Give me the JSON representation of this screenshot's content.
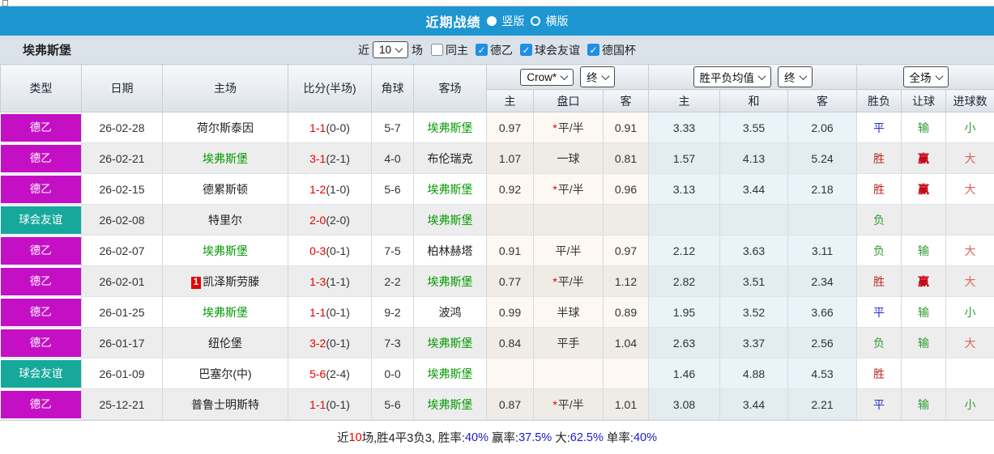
{
  "title_bar": {
    "title": "近期战绩",
    "radio_vertical_label": "竖版",
    "radio_horizontal_label": "横版"
  },
  "filter_bar": {
    "team": "埃弗斯堡",
    "near_label": "近",
    "count_value": "10",
    "games_label": "场",
    "checkboxes": [
      {
        "label": "同主",
        "checked": false
      },
      {
        "label": "德乙",
        "checked": true
      },
      {
        "label": "球会友谊",
        "checked": true
      },
      {
        "label": "德国杯",
        "checked": true
      }
    ]
  },
  "table": {
    "dropdowns": {
      "odds_company": "Crow*",
      "odds_final": "终",
      "avg_type": "胜平负均值",
      "avg_final": "终",
      "full_match": "全场"
    },
    "columns": [
      "类型",
      "日期",
      "主场",
      "比分(半场)",
      "角球",
      "客场"
    ],
    "sub_columns": [
      "主",
      "盘口",
      "客",
      "主",
      "和",
      "客",
      "胜负",
      "让球",
      "进球数"
    ],
    "rows": [
      {
        "type": "德乙",
        "type_color": "magenta",
        "date": "26-02-28",
        "home": "荷尔斯泰因",
        "home_badge": "",
        "home_is_team": false,
        "score": "1-1",
        "half": "(0-0)",
        "corner": "5-7",
        "away": "埃弗斯堡",
        "away_is_team": true,
        "odds_home": "0.97",
        "handicap_star": "*",
        "handicap": "平/半",
        "odds_away": "0.91",
        "avg_home": "3.33",
        "avg_draw": "3.55",
        "avg_away": "2.06",
        "results": [
          {
            "t": "平",
            "c": "blue"
          },
          {
            "t": "输",
            "c": "green"
          },
          {
            "t": "小",
            "c": "green"
          }
        ]
      },
      {
        "type": "德乙",
        "type_color": "magenta",
        "date": "26-02-21",
        "home": "埃弗斯堡",
        "home_badge": "",
        "home_is_team": true,
        "score": "3-1",
        "half": "(2-1)",
        "corner": "4-0",
        "away": "布伦瑞克",
        "away_is_team": false,
        "odds_home": "1.07",
        "handicap_star": "",
        "handicap": "一球",
        "odds_away": "0.81",
        "avg_home": "1.57",
        "avg_draw": "4.13",
        "avg_away": "5.24",
        "results": [
          {
            "t": "胜",
            "c": "red1"
          },
          {
            "t": "赢",
            "c": "red2"
          },
          {
            "t": "大",
            "c": "red3"
          }
        ]
      },
      {
        "type": "德乙",
        "type_color": "magenta",
        "date": "26-02-15",
        "home": "德累斯顿",
        "home_badge": "",
        "home_is_team": false,
        "score": "1-2",
        "half": "(1-0)",
        "corner": "5-6",
        "away": "埃弗斯堡",
        "away_is_team": true,
        "odds_home": "0.92",
        "handicap_star": "*",
        "handicap": "平/半",
        "odds_away": "0.96",
        "avg_home": "3.13",
        "avg_draw": "3.44",
        "avg_away": "2.18",
        "results": [
          {
            "t": "胜",
            "c": "red1"
          },
          {
            "t": "赢",
            "c": "red2"
          },
          {
            "t": "大",
            "c": "red3"
          }
        ]
      },
      {
        "type": "球会友谊",
        "type_color": "teal",
        "date": "26-02-08",
        "home": "特里尔",
        "home_badge": "",
        "home_is_team": false,
        "score": "2-0",
        "half": "(2-0)",
        "corner": "",
        "away": "埃弗斯堡",
        "away_is_team": true,
        "odds_home": "",
        "handicap_star": "",
        "handicap": "",
        "odds_away": "",
        "avg_home": "",
        "avg_draw": "",
        "avg_away": "",
        "results": [
          {
            "t": "负",
            "c": "green"
          },
          {
            "t": "",
            "c": ""
          },
          {
            "t": "",
            "c": ""
          }
        ]
      },
      {
        "type": "德乙",
        "type_color": "magenta",
        "date": "26-02-07",
        "home": "埃弗斯堡",
        "home_badge": "",
        "home_is_team": true,
        "score": "0-3",
        "half": "(0-1)",
        "corner": "7-5",
        "away": "柏林赫塔",
        "away_is_team": false,
        "odds_home": "0.91",
        "handicap_star": "",
        "handicap": "平/半",
        "odds_away": "0.97",
        "avg_home": "2.12",
        "avg_draw": "3.63",
        "avg_away": "3.11",
        "results": [
          {
            "t": "负",
            "c": "green"
          },
          {
            "t": "输",
            "c": "green"
          },
          {
            "t": "大",
            "c": "red3"
          }
        ]
      },
      {
        "type": "德乙",
        "type_color": "magenta",
        "date": "26-02-01",
        "home": "凯泽斯劳滕",
        "home_badge": "1",
        "home_is_team": false,
        "score": "1-3",
        "half": "(1-1)",
        "corner": "2-2",
        "away": "埃弗斯堡",
        "away_is_team": true,
        "odds_home": "0.77",
        "handicap_star": "*",
        "handicap": "平/半",
        "odds_away": "1.12",
        "avg_home": "2.82",
        "avg_draw": "3.51",
        "avg_away": "2.34",
        "results": [
          {
            "t": "胜",
            "c": "red1"
          },
          {
            "t": "赢",
            "c": "red2"
          },
          {
            "t": "大",
            "c": "red3"
          }
        ]
      },
      {
        "type": "德乙",
        "type_color": "magenta",
        "date": "26-01-25",
        "home": "埃弗斯堡",
        "home_badge": "",
        "home_is_team": true,
        "score": "1-1",
        "half": "(0-1)",
        "corner": "9-2",
        "away": "波鸿",
        "away_is_team": false,
        "odds_home": "0.99",
        "handicap_star": "",
        "handicap": "半球",
        "odds_away": "0.89",
        "avg_home": "1.95",
        "avg_draw": "3.52",
        "avg_away": "3.66",
        "results": [
          {
            "t": "平",
            "c": "blue"
          },
          {
            "t": "输",
            "c": "green"
          },
          {
            "t": "小",
            "c": "green"
          }
        ]
      },
      {
        "type": "德乙",
        "type_color": "magenta",
        "date": "26-01-17",
        "home": "纽伦堡",
        "home_badge": "",
        "home_is_team": false,
        "score": "3-2",
        "half": "(0-1)",
        "corner": "7-3",
        "away": "埃弗斯堡",
        "away_is_team": true,
        "odds_home": "0.84",
        "handicap_star": "",
        "handicap": "平手",
        "odds_away": "1.04",
        "avg_home": "2.63",
        "avg_draw": "3.37",
        "avg_away": "2.56",
        "results": [
          {
            "t": "负",
            "c": "green"
          },
          {
            "t": "输",
            "c": "green"
          },
          {
            "t": "大",
            "c": "red3"
          }
        ]
      },
      {
        "type": "球会友谊",
        "type_color": "teal",
        "date": "26-01-09",
        "home": "巴塞尔(中)",
        "home_badge": "",
        "home_is_team": false,
        "score": "5-6",
        "half": "(2-4)",
        "corner": "0-0",
        "away": "埃弗斯堡",
        "away_is_team": true,
        "odds_home": "",
        "handicap_star": "",
        "handicap": "",
        "odds_away": "",
        "avg_home": "1.46",
        "avg_draw": "4.88",
        "avg_away": "4.53",
        "results": [
          {
            "t": "胜",
            "c": "red1"
          },
          {
            "t": "",
            "c": ""
          },
          {
            "t": "",
            "c": ""
          }
        ]
      },
      {
        "type": "德乙",
        "type_color": "magenta",
        "date": "25-12-21",
        "home": "普鲁士明斯特",
        "home_badge": "",
        "home_is_team": false,
        "score": "1-1",
        "half": "(0-1)",
        "corner": "5-6",
        "away": "埃弗斯堡",
        "away_is_team": true,
        "odds_home": "0.87",
        "handicap_star": "*",
        "handicap": "平/半",
        "odds_away": "1.01",
        "avg_home": "3.08",
        "avg_draw": "3.44",
        "avg_away": "2.21",
        "results": [
          {
            "t": "平",
            "c": "blue"
          },
          {
            "t": "输",
            "c": "green"
          },
          {
            "t": "小",
            "c": "green"
          }
        ]
      }
    ]
  },
  "footer": {
    "segments": [
      {
        "t": "近",
        "c": "k"
      },
      {
        "t": "10",
        "c": "r"
      },
      {
        "t": "场,胜4平3负3, 胜率:",
        "c": "k"
      },
      {
        "t": "40%",
        "c": "b"
      },
      {
        "t": " 赢率:",
        "c": "k"
      },
      {
        "t": "37.5%",
        "c": "b"
      },
      {
        "t": " 大:",
        "c": "k"
      },
      {
        "t": "62.5%",
        "c": "b"
      },
      {
        "t": " 单率:",
        "c": "k"
      },
      {
        "t": "40%",
        "c": "b"
      }
    ]
  },
  "colors": {
    "magenta": "#c40fc4",
    "teal": "#16a99b",
    "title_blue": "#1e96d2",
    "team_green": "#009900",
    "score_red": "#e60000"
  }
}
